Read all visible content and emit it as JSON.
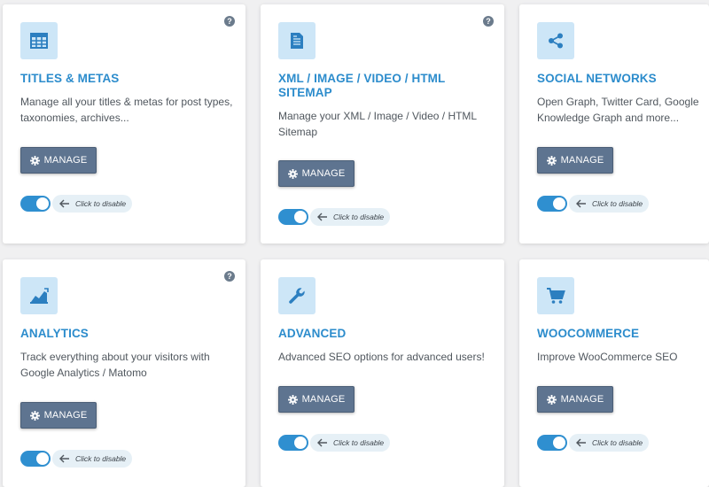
{
  "help_symbol": "?",
  "manage_label": "MANAGE",
  "toggle_hint": "Click to disable",
  "colors": {
    "accent": "#2c8ccc",
    "icon_bg": "#cde6f7",
    "button": "#5e7490",
    "toggle": "#2f8fd0"
  },
  "cards": [
    {
      "icon": "table-icon",
      "title": "TITLES & METAS",
      "description": "Manage all your titles & metas for post types, taxonomies, archives...",
      "enabled": true
    },
    {
      "icon": "document-icon",
      "title": "XML / IMAGE / VIDEO / HTML SITEMAP",
      "description": "Manage your XML / Image / Video / HTML Sitemap",
      "enabled": true
    },
    {
      "icon": "share-icon",
      "title": "SOCIAL NETWORKS",
      "description": "Open Graph, Twitter Card, Google Knowledge Graph and more...",
      "enabled": true
    },
    {
      "icon": "chart-icon",
      "title": "ANALYTICS",
      "description": "Track everything about your visitors with Google Analytics / Matomo",
      "enabled": true
    },
    {
      "icon": "wrench-icon",
      "title": "ADVANCED",
      "description": "Advanced SEO options for advanced users!",
      "enabled": true
    },
    {
      "icon": "cart-icon",
      "title": "WOOCOMMERCE",
      "description": "Improve WooCommerce SEO",
      "enabled": true
    }
  ]
}
